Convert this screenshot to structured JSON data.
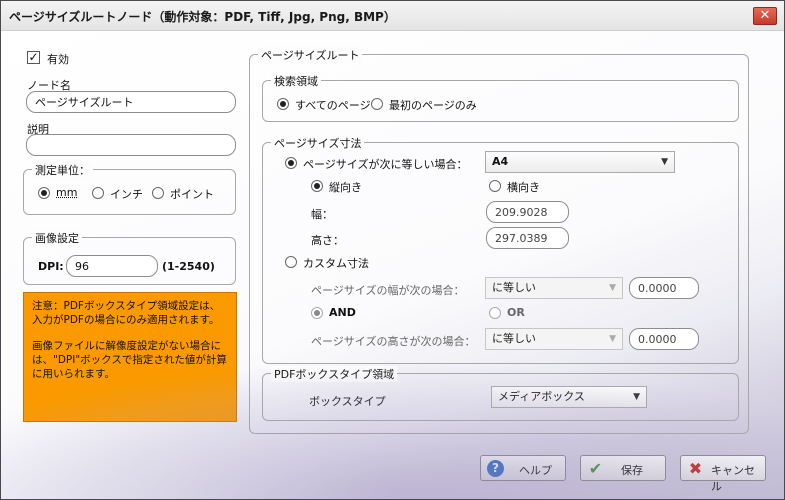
{
  "window": {
    "title": "ページサイズルートノード（動作対象：PDF, Tiff, Jpg, Png, BMP）",
    "close_glyph": "✕"
  },
  "left": {
    "enabled_label": "有効",
    "enabled_checked": true,
    "node_name_label": "ノード名",
    "node_name_value": "ページサイズルート",
    "description_label": "説明",
    "description_value": "",
    "units": {
      "legend": "測定単位：",
      "options": [
        "mm",
        "インチ",
        "ポイント"
      ],
      "selected": "mm"
    },
    "image_settings": {
      "legend": "画像設定",
      "dpi_label": "DPI:",
      "dpi_value": "96",
      "dpi_range": "(1-2540)"
    },
    "notice": {
      "line1": "注意：PDFボックスタイプ領域設定は、入力がPDFの場合にのみ適用されます。",
      "line2": "画像ファイルに解像度設定がない場合には、\"DPI\"ボックスで指定された値が計算に用いられます。"
    }
  },
  "right": {
    "legend": "ページサイズルート",
    "search_area": {
      "legend": "検索領域",
      "options": [
        "すべてのページ",
        "最初のページのみ"
      ],
      "selected": "すべてのページ"
    },
    "page_size": {
      "legend": "ページサイズ寸法",
      "equal_option_label": "ページサイズが次に等しい場合：",
      "paper_value": "A4",
      "portrait_label": "縦向き",
      "landscape_label": "横向き",
      "orientation_selected": "縦向き",
      "width_label": "幅：",
      "width_value": "209.9028",
      "height_label": "高さ：",
      "height_value": "297.0389",
      "custom_label": "カスタム寸法",
      "custom_width_label": "ページサイズの幅が次の場合：",
      "custom_width_op": "に等しい",
      "custom_width_value": "0.0000",
      "and_label": "AND",
      "or_label": "OR",
      "logic_selected": "AND",
      "custom_height_label": "ページサイズの高さが次の場合：",
      "custom_height_op": "に等しい",
      "custom_height_value": "0.0000"
    },
    "pdf_box": {
      "legend": "PDFボックスタイプ領域",
      "box_type_label": "ボックスタイプ",
      "box_type_value": "メディアボックス"
    }
  },
  "buttons": {
    "help": "ヘルプ",
    "save": "保存",
    "cancel": "キャンセル"
  },
  "colors": {
    "notice_bg": "#fa9a00",
    "help_icon": "#2f6fc2",
    "save_icon": "#3a9a2a",
    "cancel_icon": "#c4271d"
  }
}
